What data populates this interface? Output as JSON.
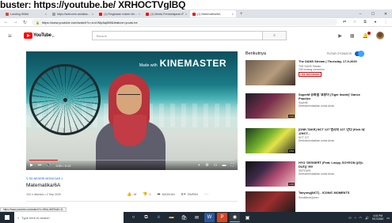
{
  "caption": "buster: https://youtube.be/ XRHOCTVglBQ",
  "browser": {
    "tabs": [
      {
        "label": "Landing Wiiliol",
        "active": false,
        "color": "#db4437"
      },
      {
        "label": "https://welcome.ashiaba...",
        "active": false,
        "color": "#9aa0a6"
      },
      {
        "label": "(1) Ringkasan materi ele...",
        "active": false,
        "color": "#ff0000"
      },
      {
        "label": "(1) Media Pembelajaran IP...",
        "active": false,
        "color": "#ff0000"
      },
      {
        "label": "(1) Matematika/6A",
        "active": true,
        "color": "#ff0000"
      }
    ],
    "new_tab": "+",
    "url": "https://www.youtube.com/watch?v=d-sVMpAq8MI&feature=youtu.be"
  },
  "youtube": {
    "logo": "YouTube",
    "country_code": "ID",
    "search_placeholder": "Telusuri"
  },
  "player": {
    "watermark_small": "Made with",
    "watermark_big": "KINEMASTER",
    "time": "0:00 / 0:12",
    "progress_fraction": 0.14
  },
  "video": {
    "tagline": "SD NEGERI MONCOAR 1",
    "title": "Matematika/6A",
    "meta": "103 x ditonton • 2 Sep 2020",
    "likes": "18",
    "dislikes": "0",
    "share_label": "BAGIKAN",
    "save_label": "SIMPAN"
  },
  "sidebar": {
    "heading": "Berikutnya",
    "autoplay_label": "PUTAR OTOMATIS",
    "items": [
      {
        "title": "The DANS Stream | Thursday, 17-9-2020",
        "channel": "THE DANS Stream",
        "sub": "205 sedang menonton",
        "badge": "LIVE SEKARANG",
        "duration": ""
      },
      {
        "title": "SuperM 슈퍼엠 '호랑이 (Tiger Inside)' Dance Practice",
        "channel": "SuperM",
        "sub": "Direkomendasikan untuk Anda",
        "badge": "",
        "duration": "3:33"
      },
      {
        "title": "[ONE-TAKE] NCT 127 엔시티 127 '간다 (Kick It)' @NCT...",
        "channel": "NCT 127",
        "sub": "Direkomendasikan untuk Anda",
        "badge": "",
        "duration": "3:54"
      },
      {
        "title": "HYO 'DESSERT (Feat. Loopy, SOYEON ((G)I-DLE))' MV",
        "channel": "SMTOWN",
        "sub": "Direkomendasikan untuk Anda",
        "badge": "",
        "duration": "3:35"
      },
      {
        "title": "Taeyong(NCT) - ICONIC MOMENTS",
        "channel": "SmoldtensQueen",
        "sub": "",
        "badge": "",
        "duration": ""
      }
    ]
  },
  "status_url": "https://www.youtube.com/watch?v=rf9rcLdKE9c&t=11",
  "taskbar": {
    "search_placeholder": "Type here to search",
    "time": "4:01 PM",
    "date": "9/17/2020"
  }
}
